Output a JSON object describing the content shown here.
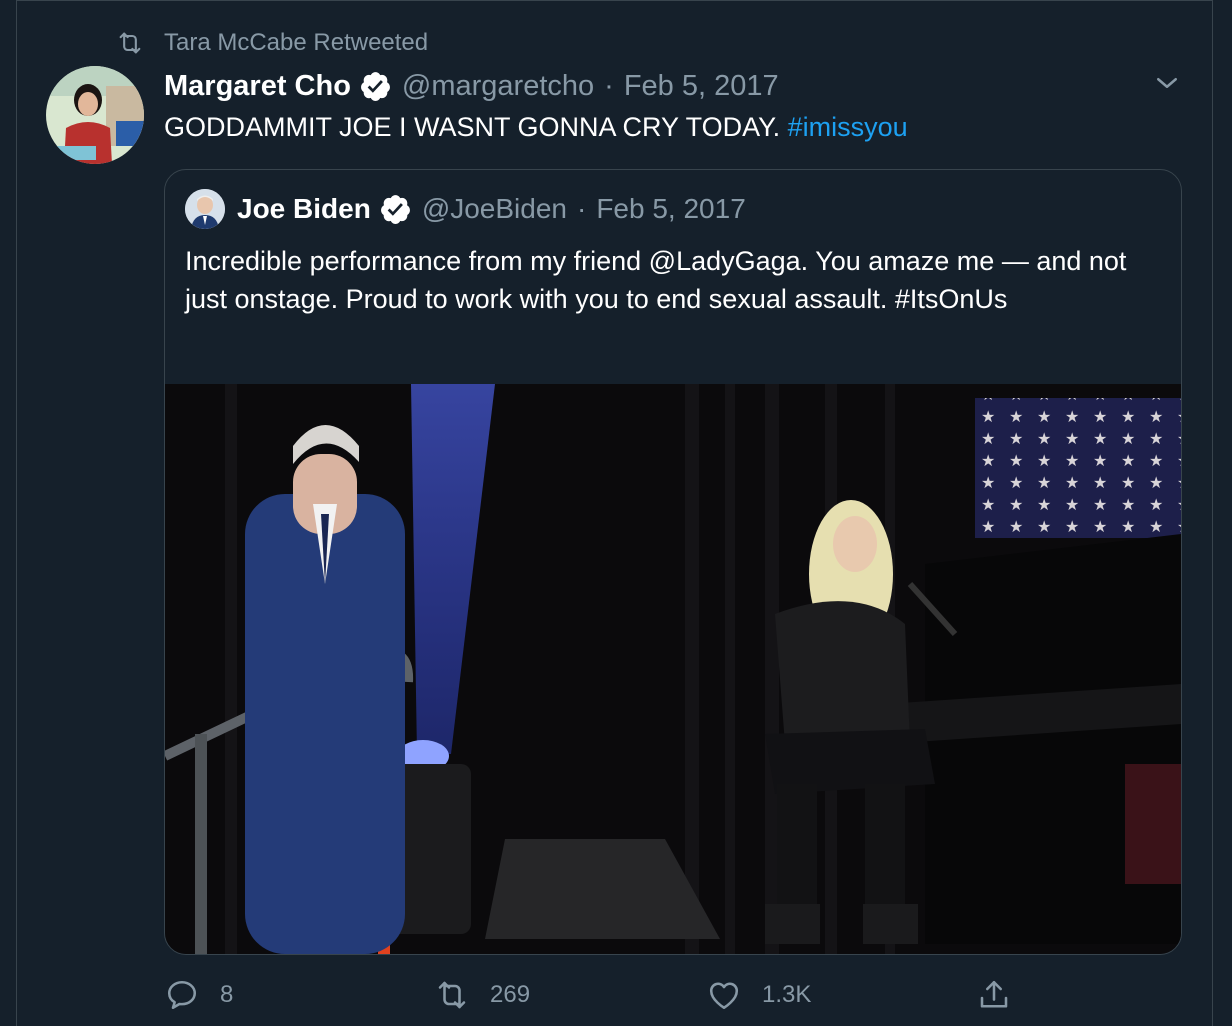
{
  "retweet": {
    "label": "Tara McCabe Retweeted",
    "icon": "retweet-icon"
  },
  "tweet": {
    "author_name": "Margaret Cho",
    "handle": "@margaretcho",
    "separator": "·",
    "date": "Feb 5, 2017",
    "text": "GODDAMMIT JOE I WASNT GONNA CRY TODAY.",
    "hashtag": "#imissyou",
    "verified": true
  },
  "quote": {
    "author_name": "Joe Biden",
    "handle": "@JoeBiden",
    "separator": "·",
    "date": "Feb 5, 2017",
    "text": "Incredible performance from my friend @LadyGaga. You amaze me — and not just onstage. Proud to work with you to end sexual assault. #ItsOnUs",
    "verified": true
  },
  "actions": {
    "reply_count": "8",
    "retweet_count": "269",
    "like_count": "1.3K"
  },
  "colors": {
    "background": "#15202b",
    "border": "#38444d",
    "muted": "#8899a6",
    "accent": "#1da1f2"
  }
}
